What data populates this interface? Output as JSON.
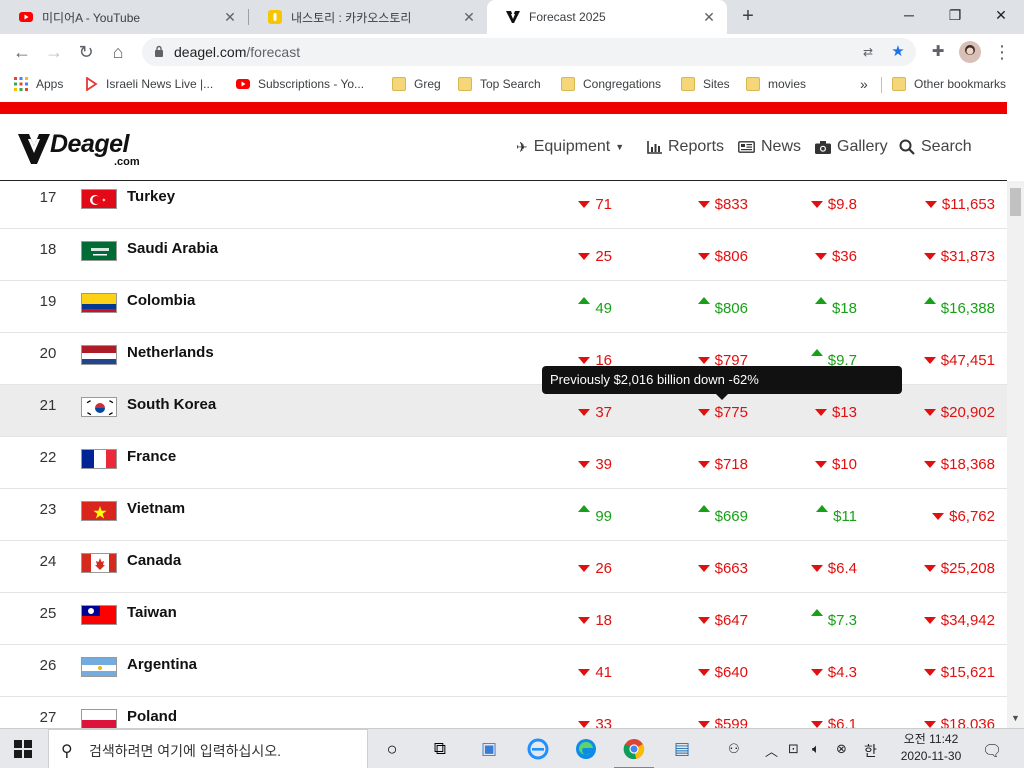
{
  "browser": {
    "tabs": [
      {
        "label": "미디어A - YouTube",
        "favicon": "youtube-icon",
        "active": false
      },
      {
        "label": "내스토리 : 카카오스토리",
        "favicon": "kakaostory-icon",
        "active": false
      },
      {
        "label": "Forecast 2025",
        "favicon": "deagel-icon",
        "active": true
      }
    ],
    "new_tab": "+",
    "url_host": "deagel.com",
    "url_path": "/forecast",
    "bookmarks": [
      {
        "label": "Apps",
        "icon": "apps-grid-icon"
      },
      {
        "label": "Israeli News Live |...",
        "icon": "play-icon"
      },
      {
        "label": "Subscriptions - Yo...",
        "icon": "youtube-icon"
      },
      {
        "label": "Greg",
        "icon": "folder-icon"
      },
      {
        "label": "Top Search",
        "icon": "folder-icon"
      },
      {
        "label": "Congregations",
        "icon": "folder-icon"
      },
      {
        "label": "Sites",
        "icon": "folder-icon"
      },
      {
        "label": "movies",
        "icon": "folder-icon"
      }
    ],
    "bookmarks_overflow": "»",
    "other_bookmarks": "Other bookmarks"
  },
  "site": {
    "logo_word": "Deagel",
    "logo_suffix": ".com",
    "nav": [
      {
        "label": "Equipment",
        "icon": "airplane-icon",
        "dropdown": true
      },
      {
        "label": "Reports",
        "icon": "bar-chart-icon",
        "dropdown": false
      },
      {
        "label": "News",
        "icon": "newspaper-icon",
        "dropdown": false
      },
      {
        "label": "Gallery",
        "icon": "camera-icon",
        "dropdown": false
      },
      {
        "label": "Search",
        "icon": "search-icon",
        "dropdown": false
      }
    ],
    "tooltip": "Previously $2,016 billion down -62%",
    "rows": [
      {
        "rank": "17",
        "country": "Turkey",
        "flag": "turkey",
        "c1": {
          "v": "71",
          "t": "down"
        },
        "c2": {
          "v": "$833",
          "t": "down"
        },
        "c3": {
          "v": "$9.8",
          "t": "down"
        },
        "c4": {
          "v": "$11,653",
          "t": "down"
        }
      },
      {
        "rank": "18",
        "country": "Saudi Arabia",
        "flag": "saudi",
        "c1": {
          "v": "25",
          "t": "down"
        },
        "c2": {
          "v": "$806",
          "t": "down"
        },
        "c3": {
          "v": "$36",
          "t": "down"
        },
        "c4": {
          "v": "$31,873",
          "t": "down"
        }
      },
      {
        "rank": "19",
        "country": "Colombia",
        "flag": "colombia",
        "c1": {
          "v": "49",
          "t": "up"
        },
        "c2": {
          "v": "$806",
          "t": "up"
        },
        "c3": {
          "v": "$18",
          "t": "up"
        },
        "c4": {
          "v": "$16,388",
          "t": "up"
        }
      },
      {
        "rank": "20",
        "country": "Netherlands",
        "flag": "netherlands",
        "c1": {
          "v": "16",
          "t": "down"
        },
        "c2": {
          "v": "$797",
          "t": "down"
        },
        "c3": {
          "v": "$9.7",
          "t": "up"
        },
        "c4": {
          "v": "$47,451",
          "t": "down"
        }
      },
      {
        "rank": "21",
        "country": "South Korea",
        "flag": "korea",
        "c1": {
          "v": "37",
          "t": "down"
        },
        "c2": {
          "v": "$775",
          "t": "down"
        },
        "c3": {
          "v": "$13",
          "t": "down"
        },
        "c4": {
          "v": "$20,902",
          "t": "down"
        }
      },
      {
        "rank": "22",
        "country": "France",
        "flag": "france",
        "c1": {
          "v": "39",
          "t": "down"
        },
        "c2": {
          "v": "$718",
          "t": "down"
        },
        "c3": {
          "v": "$10",
          "t": "down"
        },
        "c4": {
          "v": "$18,368",
          "t": "down"
        }
      },
      {
        "rank": "23",
        "country": "Vietnam",
        "flag": "vietnam",
        "c1": {
          "v": "99",
          "t": "up"
        },
        "c2": {
          "v": "$669",
          "t": "up"
        },
        "c3": {
          "v": "$11",
          "t": "up"
        },
        "c4": {
          "v": "$6,762",
          "t": "down"
        }
      },
      {
        "rank": "24",
        "country": "Canada",
        "flag": "canada",
        "c1": {
          "v": "26",
          "t": "down"
        },
        "c2": {
          "v": "$663",
          "t": "down"
        },
        "c3": {
          "v": "$6.4",
          "t": "down"
        },
        "c4": {
          "v": "$25,208",
          "t": "down"
        }
      },
      {
        "rank": "25",
        "country": "Taiwan",
        "flag": "taiwan",
        "c1": {
          "v": "18",
          "t": "down"
        },
        "c2": {
          "v": "$647",
          "t": "down"
        },
        "c3": {
          "v": "$7.3",
          "t": "up"
        },
        "c4": {
          "v": "$34,942",
          "t": "down"
        }
      },
      {
        "rank": "26",
        "country": "Argentina",
        "flag": "argentina",
        "c1": {
          "v": "41",
          "t": "down"
        },
        "c2": {
          "v": "$640",
          "t": "down"
        },
        "c3": {
          "v": "$4.3",
          "t": "down"
        },
        "c4": {
          "v": "$15,621",
          "t": "down"
        }
      },
      {
        "rank": "27",
        "country": "Poland",
        "flag": "poland",
        "c1": {
          "v": "33",
          "t": "down"
        },
        "c2": {
          "v": "$599",
          "t": "down"
        },
        "c3": {
          "v": "$6.1",
          "t": "down"
        },
        "c4": {
          "v": "$18,036",
          "t": "down"
        }
      }
    ]
  },
  "taskbar": {
    "search_placeholder": "검색하려면 여기에 입력하십시오.",
    "ime": "한",
    "time": "오전 11:42",
    "date": "2020-11-30"
  },
  "colors": {
    "accent_red": "#ee0000",
    "down": "#e01010",
    "up": "#18a018"
  }
}
